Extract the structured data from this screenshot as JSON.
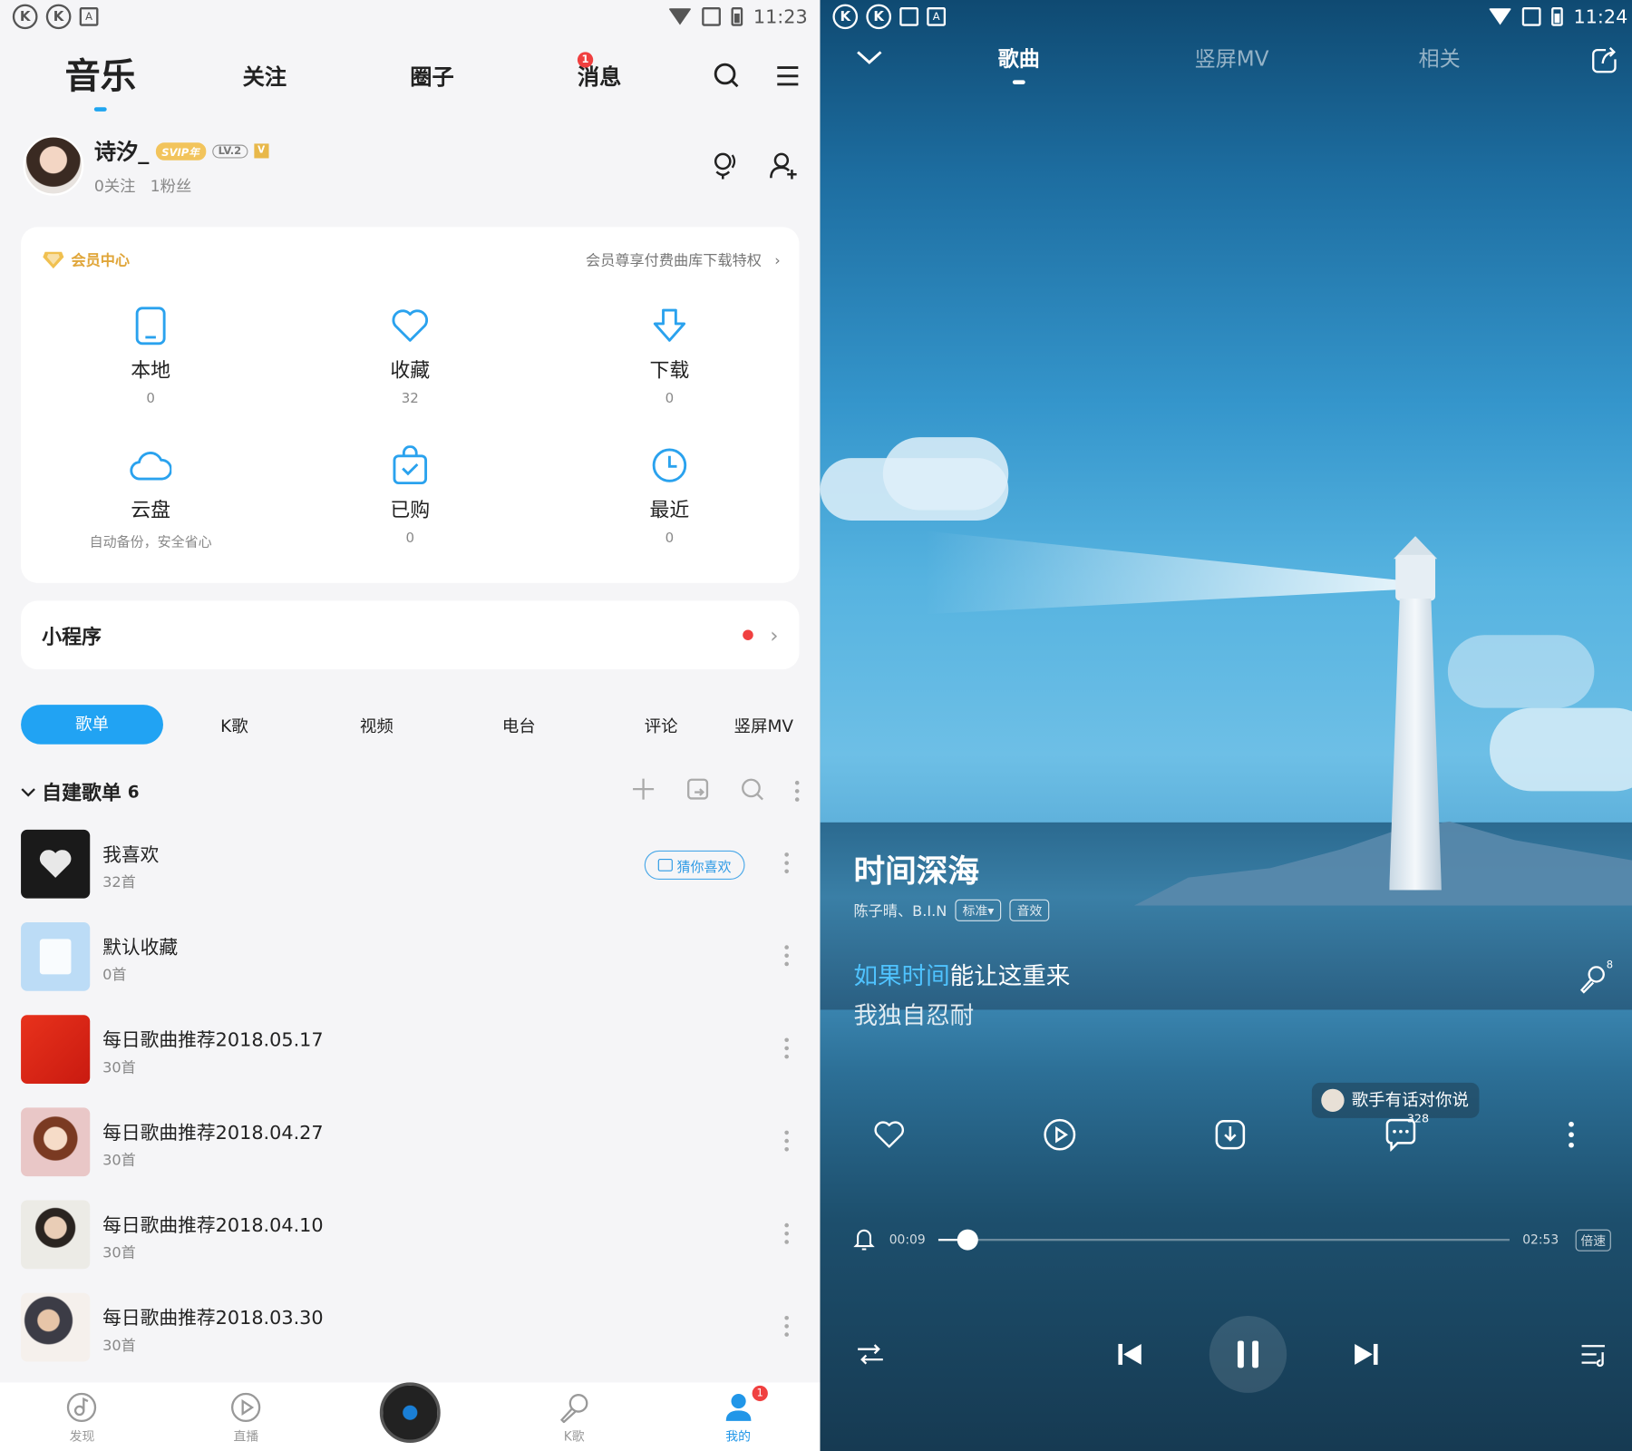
{
  "left": {
    "status": {
      "time": "11:23"
    },
    "topnav": {
      "music": "音乐",
      "follow": "关注",
      "circle": "圈子",
      "messages": "消息",
      "messages_badge": "1"
    },
    "profile": {
      "name": "诗汐_",
      "svip": "SVIP年",
      "level": "LV.2",
      "vip_mark": "V",
      "following": "0关注",
      "fans": "1粉丝"
    },
    "vip": {
      "title": "会员中心",
      "promo": "会员尊享付费曲库下载特权"
    },
    "grid": [
      {
        "label": "本地",
        "count": "0",
        "icon": "phone-icon"
      },
      {
        "label": "收藏",
        "count": "32",
        "icon": "heart-icon"
      },
      {
        "label": "下载",
        "count": "0",
        "icon": "download-icon"
      },
      {
        "label": "云盘",
        "count": "自动备份，安全省心",
        "icon": "cloud-icon"
      },
      {
        "label": "已购",
        "count": "0",
        "icon": "bag-icon"
      },
      {
        "label": "最近",
        "count": "0",
        "icon": "clock-icon"
      }
    ],
    "mini": {
      "label": "小程序"
    },
    "tabs": [
      "歌单",
      "K歌",
      "视频",
      "电台",
      "评论",
      "竖屏MV"
    ],
    "playlist_header": {
      "title": "自建歌单",
      "count": "6"
    },
    "playlists": [
      {
        "title": "我喜欢",
        "sub": "32首",
        "guess": "猜你喜欢"
      },
      {
        "title": "默认收藏",
        "sub": "0首"
      },
      {
        "title": "每日歌曲推荐2018.05.17",
        "sub": "30首"
      },
      {
        "title": "每日歌曲推荐2018.04.27",
        "sub": "30首"
      },
      {
        "title": "每日歌曲推荐2018.04.10",
        "sub": "30首"
      },
      {
        "title": "每日歌曲推荐2018.03.30",
        "sub": "30首"
      }
    ],
    "bottom": [
      {
        "label": "发现",
        "icon": "discover-icon"
      },
      {
        "label": "直播",
        "icon": "live-icon"
      },
      {
        "label": "",
        "icon": "disc-icon"
      },
      {
        "label": "K歌",
        "icon": "mic-icon"
      },
      {
        "label": "我的",
        "icon": "me-icon",
        "badge": "1"
      }
    ],
    "accent": "#21a3f3"
  },
  "right": {
    "status": {
      "time": "11:24"
    },
    "tabs": {
      "song": "歌曲",
      "mv": "竖屏MV",
      "related": "相关"
    },
    "song": {
      "title": "时间深海",
      "artist": "陈子晴、B.I.N",
      "quality": "标准▾",
      "effect": "音效"
    },
    "lyrics": {
      "line1_hl": "如果时间",
      "line1_rest": "能让这重来",
      "line2": "我独自忍耐",
      "mic_count": "8"
    },
    "bubble": "歌手有话对你说",
    "comment_count": "328",
    "progress": {
      "current": "00:09",
      "total": "02:53",
      "speed": "倍速",
      "fraction": 0.052
    }
  }
}
